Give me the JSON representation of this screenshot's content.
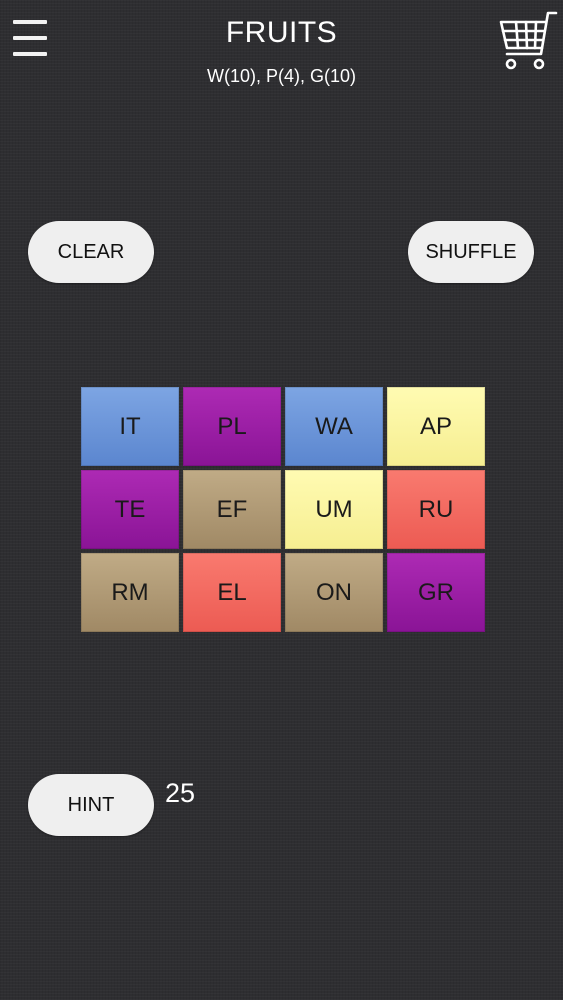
{
  "header": {
    "title": "FRUITS",
    "subtitle": "W(10), P(4), G(10)"
  },
  "icons": {
    "menu": "hamburger-menu-icon",
    "cart": "shopping-cart-icon"
  },
  "buttons": {
    "clear": "CLEAR",
    "shuffle": "SHUFFLE",
    "hint": "HINT"
  },
  "hint_count": "25",
  "colors": {
    "background": "#2e2e31",
    "blue": "#6b94d8",
    "purple": "#9c1fa5",
    "yellow": "#fbf5a3",
    "tan": "#b09a76",
    "red": "#f26a61",
    "button": "#efefef"
  },
  "board": {
    "rows": [
      [
        {
          "text": "IT",
          "color": "blue"
        },
        {
          "text": "PL",
          "color": "purple"
        },
        {
          "text": "WA",
          "color": "blue"
        },
        {
          "text": "AP",
          "color": "yellow"
        }
      ],
      [
        {
          "text": "TE",
          "color": "purple"
        },
        {
          "text": "EF",
          "color": "tan"
        },
        {
          "text": "UM",
          "color": "yellow"
        },
        {
          "text": "RU",
          "color": "red"
        }
      ],
      [
        {
          "text": "RM",
          "color": "tan"
        },
        {
          "text": "EL",
          "color": "red"
        },
        {
          "text": "ON",
          "color": "tan"
        },
        {
          "text": "GR",
          "color": "purple"
        }
      ]
    ]
  }
}
